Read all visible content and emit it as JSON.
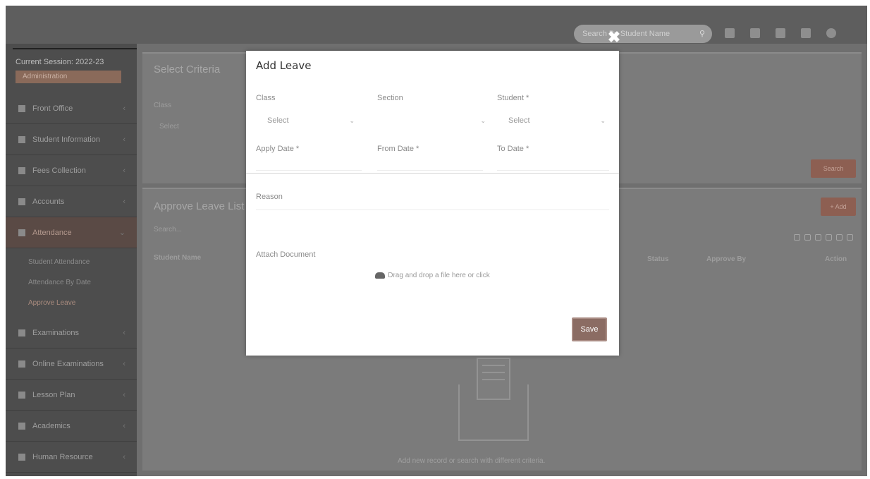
{
  "app": {
    "session_label": "Current Session: 2022-23",
    "session_badge": "Administration",
    "search_placeholder": "Search By Student Name",
    "sidebar": {
      "items": [
        {
          "label": "Front Office"
        },
        {
          "label": "Student Information"
        },
        {
          "label": "Fees Collection"
        },
        {
          "label": "Accounts"
        },
        {
          "label": "Attendance"
        },
        {
          "label": "Examinations"
        },
        {
          "label": "Online Examinations"
        },
        {
          "label": "Lesson Plan"
        },
        {
          "label": "Academics"
        },
        {
          "label": "Human Resource"
        }
      ],
      "sub_items": [
        {
          "label": "Student Attendance"
        },
        {
          "label": "Attendance By Date"
        },
        {
          "label": "Approve Leave"
        }
      ]
    },
    "criteria": {
      "title": "Select Criteria",
      "class_label": "Class",
      "class_value": "Select",
      "search_button": "Search"
    },
    "leave_list": {
      "title": "Approve Leave List",
      "add_button": "+ Add",
      "search_placeholder": "Search...",
      "columns": [
        "Student Name",
        "Status",
        "Approve By",
        "Action"
      ],
      "empty_text": "Add new record or search with different criteria."
    }
  },
  "modal": {
    "title": "Add Leave",
    "close_glyph": "✖",
    "fields": {
      "class_label": "Class",
      "class_value": "Select",
      "section_label": "Section",
      "section_value": "",
      "student_label": "Student *",
      "student_value": "Select",
      "apply_date_label": "Apply Date *",
      "from_date_label": "From Date *",
      "to_date_label": "To Date *",
      "reason_label": "Reason",
      "attach_label": "Attach Document"
    },
    "dropzone_text": "Drag and drop a file here or click",
    "save_button": "Save"
  },
  "colors": {
    "overlay": "#7a7a7a",
    "modal_bg": "#ffffff",
    "save_button": "#8b6c63"
  }
}
